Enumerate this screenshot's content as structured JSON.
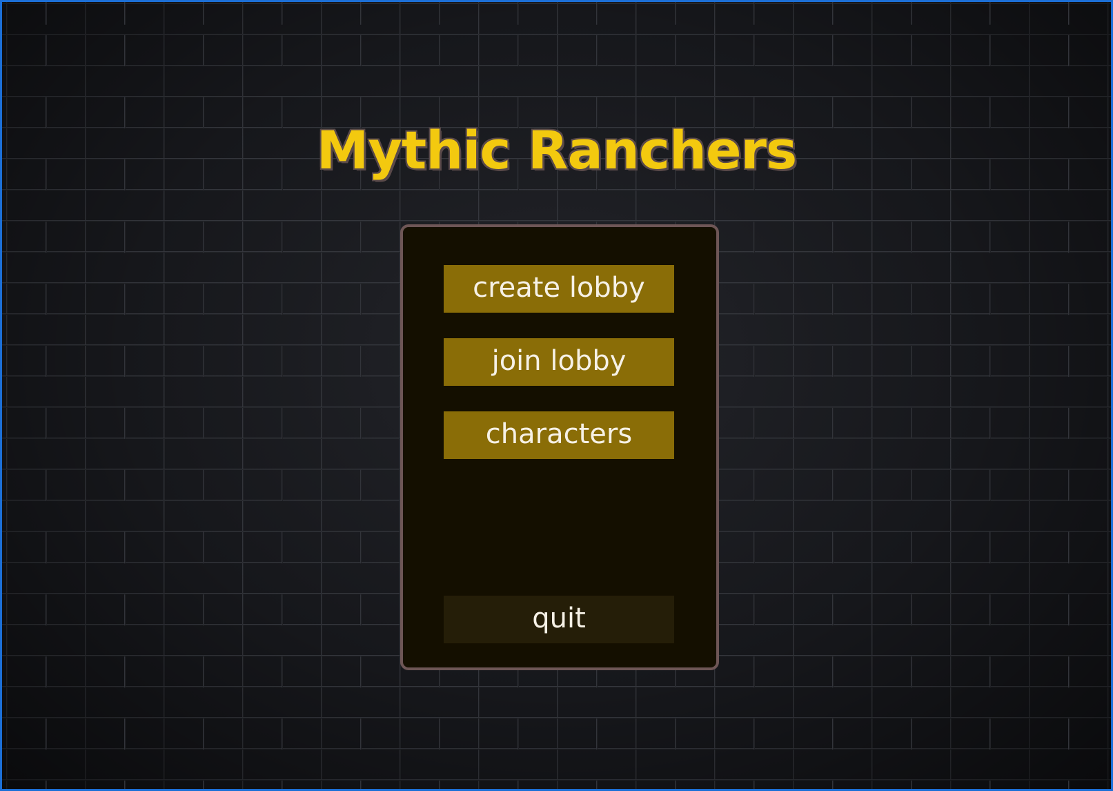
{
  "title": "Mythic Ranchers",
  "menu": {
    "create_lobby_label": "create lobby",
    "join_lobby_label": "join lobby",
    "characters_label": "characters",
    "quit_label": "quit"
  },
  "colors": {
    "title_fill": "#f3c90f",
    "title_outline": "#5a4a4a",
    "panel_bg": "#140f00",
    "panel_border": "#6e5656",
    "button_bg": "#8a6d07",
    "quit_button_bg": "#251e08",
    "button_text": "#f6f1e6",
    "window_border": "#1c6fd6"
  }
}
